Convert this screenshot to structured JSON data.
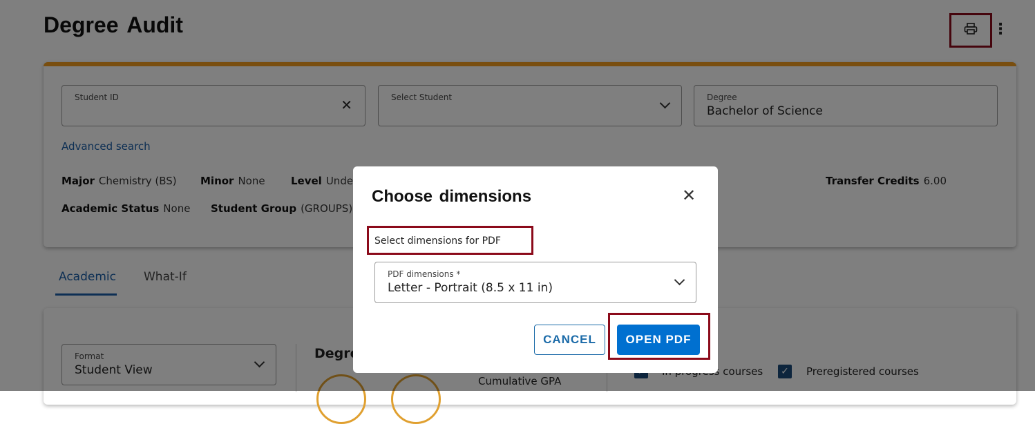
{
  "page": {
    "title": "Degree Audit"
  },
  "header": {
    "print_icon": "printer-icon",
    "more_icon": "more-vertical-icon"
  },
  "search": {
    "student_id": {
      "label": "Student ID",
      "value": ""
    },
    "select_student": {
      "label": "Select Student",
      "value": ""
    },
    "degree": {
      "label": "Degree",
      "value": "Bachelor of Science"
    },
    "advanced_search": "Advanced search"
  },
  "info": {
    "major_label": "Major",
    "major": "Chemistry (BS)",
    "minor_label": "Minor",
    "minor": "None",
    "level_label": "Level",
    "level": "Unde",
    "transfer_label": "Transfer Credits",
    "transfer": "6.00",
    "status_label": "Academic Status",
    "status": "None",
    "group_label": "Student Group",
    "group": "(GROUPS)E"
  },
  "tabs": [
    {
      "label": "Academic",
      "active": true
    },
    {
      "label": "What-If",
      "active": false
    }
  ],
  "audit": {
    "format_label": "Format",
    "format_value": "Student View",
    "degree_heading": "Degre",
    "gpa_label": "Cumulative GPA",
    "in_progress": "In progress courses",
    "preregistered": "Preregistered courses"
  },
  "dialog": {
    "title": "Choose dimensions",
    "instruction": "Select dimensions for PDF",
    "select_label": "PDF dimensions *",
    "select_value": "Letter - Portrait (8.5 x 11 in)",
    "cancel": "CANCEL",
    "open": "OPEN PDF"
  },
  "colors": {
    "accent": "#0070d0",
    "highlight": "#8b0a1a",
    "card_top": "#f29c1f"
  }
}
